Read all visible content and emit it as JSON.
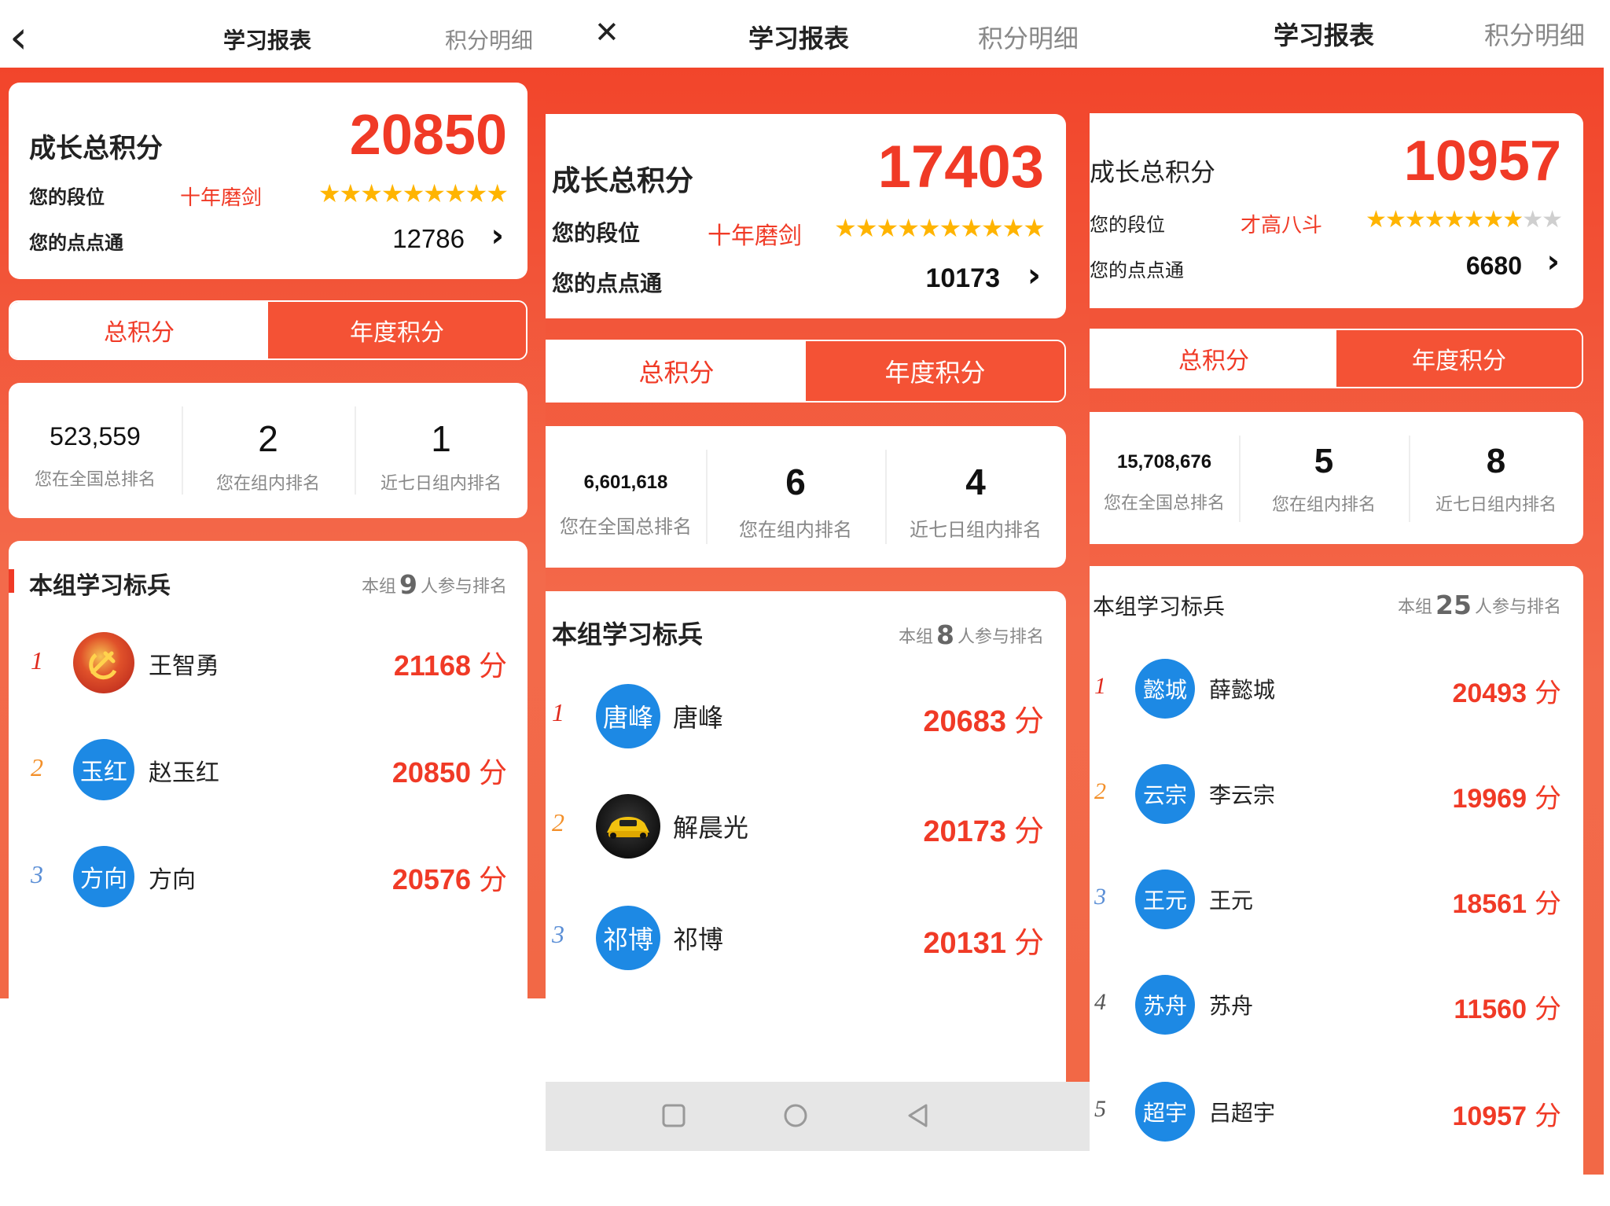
{
  "colors": {
    "accent": "#f03a26",
    "avatar_bg": "#1d89e4",
    "star": "#ffb400"
  },
  "panels": [
    {
      "nav": {
        "left_icon": "back-arrow-icon",
        "left_glyph": "‹",
        "title": "学习报表",
        "right": "积分明细"
      },
      "summary": {
        "total_label": "成长总积分",
        "total": "20850",
        "rank_label": "您的段位",
        "rank_name": "十年磨剑",
        "stars_on": "★★★★★★★★★",
        "stars_off": "",
        "points_label": "您的点点通",
        "points": "12786",
        "chevron": "›"
      },
      "tabs": {
        "total": "总积分",
        "annual": "年度积分"
      },
      "stats": [
        {
          "value": "523,559",
          "label": "您在全国总排名"
        },
        {
          "value": "2",
          "label": "您在组内排名"
        },
        {
          "value": "1",
          "label": "近七日组内排名"
        }
      ],
      "section": {
        "title": "本组学习标兵",
        "count_prefix": "本组",
        "count": "9",
        "count_suffix": "人参与排名"
      },
      "rows": [
        {
          "index": "1",
          "avatar_text": "",
          "avatar_icon": "party-emblem-icon",
          "name": "王智勇",
          "score": "21168",
          "unit": "分"
        },
        {
          "index": "2",
          "avatar_text": "玉红",
          "name": "赵玉红",
          "score": "20850",
          "unit": "分"
        },
        {
          "index": "3",
          "avatar_text": "方向",
          "name": "方向",
          "score": "20576",
          "unit": "分"
        }
      ]
    },
    {
      "nav": {
        "left_icon": "close-icon",
        "left_glyph": "✕",
        "title": "学习报表",
        "right": "积分明细"
      },
      "summary": {
        "total_label": "成长总积分",
        "total": "17403",
        "rank_label": "您的段位",
        "rank_name": "十年磨剑",
        "stars_on": "★★★★★★★★★★",
        "stars_off": "",
        "points_label": "您的点点通",
        "points": "10173",
        "chevron": "›"
      },
      "tabs": {
        "total": "总积分",
        "annual": "年度积分"
      },
      "stats": [
        {
          "value": "6,601,618",
          "label": "您在全国总排名"
        },
        {
          "value": "6",
          "label": "您在组内排名"
        },
        {
          "value": "4",
          "label": "近七日组内排名"
        }
      ],
      "section": {
        "title": "本组学习标兵",
        "count_prefix": "本组",
        "count": "8",
        "count_suffix": "人参与排名"
      },
      "rows": [
        {
          "index": "1",
          "avatar_text": "唐峰",
          "name": "唐峰",
          "score": "20683",
          "unit": "分"
        },
        {
          "index": "2",
          "avatar_text": "",
          "avatar_icon": "car-photo-icon",
          "name": "解晨光",
          "score": "20173",
          "unit": "分"
        },
        {
          "index": "3",
          "avatar_text": "祁博",
          "name": "祁博",
          "score": "20131",
          "unit": "分"
        }
      ],
      "sysbar": {
        "square": "square-icon",
        "circle": "circle-icon",
        "back": "triangle-back-icon"
      }
    },
    {
      "nav": {
        "left_icon": "",
        "left_glyph": "",
        "title": "学习报表",
        "right": "积分明细"
      },
      "summary": {
        "total_label": "成长总积分",
        "total": "10957",
        "rank_label": "您的段位",
        "rank_name": "才高八斗",
        "stars_on": "★★★★★★★★",
        "stars_off": "★★",
        "points_label": "您的点点通",
        "points": "6680",
        "chevron": "›"
      },
      "tabs": {
        "total": "总积分",
        "annual": "年度积分"
      },
      "stats": [
        {
          "value": "15,708,676",
          "label": "您在全国总排名"
        },
        {
          "value": "5",
          "label": "您在组内排名"
        },
        {
          "value": "8",
          "label": "近七日组内排名"
        }
      ],
      "section": {
        "title": "本组学习标兵",
        "count_prefix": "本组",
        "count": "25",
        "count_suffix": "人参与排名"
      },
      "rows": [
        {
          "index": "1",
          "avatar_text": "懿城",
          "name": "薛懿城",
          "score": "20493",
          "unit": "分"
        },
        {
          "index": "2",
          "avatar_text": "云宗",
          "name": "李云宗",
          "score": "19969",
          "unit": "分"
        },
        {
          "index": "3",
          "avatar_text": "王元",
          "name": "王元",
          "score": "18561",
          "unit": "分"
        },
        {
          "index": "4",
          "avatar_text": "苏舟",
          "name": "苏舟",
          "score": "11560",
          "unit": "分"
        },
        {
          "index": "5",
          "avatar_text": "超宇",
          "name": "吕超宇",
          "score": "10957",
          "unit": "分"
        }
      ]
    }
  ]
}
